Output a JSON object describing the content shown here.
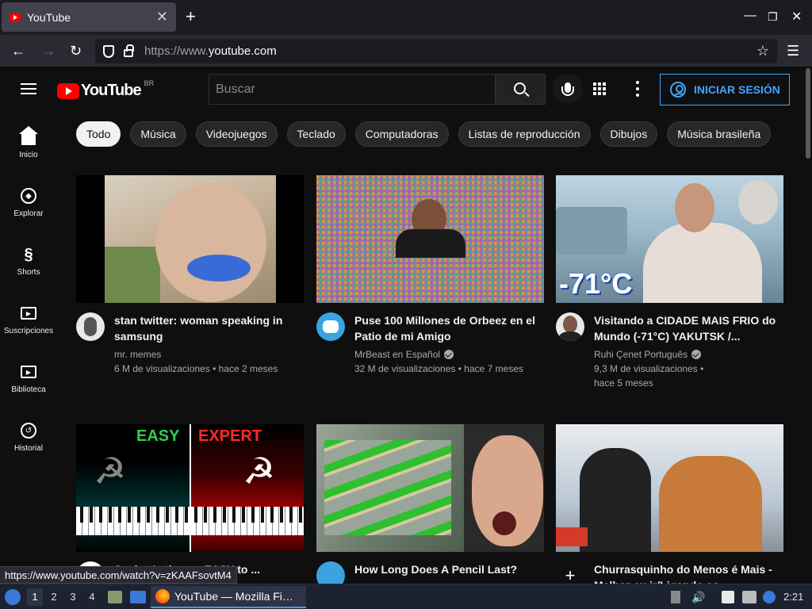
{
  "browser": {
    "tab_title": "YouTube",
    "url_prefix": "https://www.",
    "url_domain": "youtube.com",
    "status_link": "https://www.youtube.com/watch?v=zKAAFsovtM4"
  },
  "header": {
    "logo_text": "YouTube",
    "country_code": "BR",
    "search_placeholder": "Buscar",
    "signin_label": "INICIAR SESIÓN"
  },
  "sidebar": {
    "items": [
      {
        "label": "Inicio"
      },
      {
        "label": "Explorar"
      },
      {
        "label": "Shorts"
      },
      {
        "label": "Suscripciones"
      },
      {
        "label": "Biblioteca"
      },
      {
        "label": "Historial"
      }
    ]
  },
  "chips": [
    {
      "label": "Todo"
    },
    {
      "label": "Música"
    },
    {
      "label": "Videojuegos"
    },
    {
      "label": "Teclado"
    },
    {
      "label": "Computadoras"
    },
    {
      "label": "Listas de reproducción"
    },
    {
      "label": "Dibujos"
    },
    {
      "label": "Música brasileña"
    }
  ],
  "videos": [
    {
      "title": "stan twitter: woman speaking in samsung",
      "channel": "mr. memes",
      "verified": false,
      "views": "6 M de visualizaciones",
      "age": "hace 2 meses"
    },
    {
      "title": "Puse 100 Millones de Orbeez en el Patio de mi Amigo",
      "channel": "MrBeast en Español",
      "verified": true,
      "views": "32 M de visualizaciones",
      "age": "hace 7 meses"
    },
    {
      "title": "Visitando a CIDADE MAIS FRIO do Mundo (-71°C) YAKUTSK /...",
      "channel": "Ruhi Çenet Português",
      "verified": true,
      "views": "9,3 M de visualizaciones",
      "age": "hace 5 meses",
      "thumb_text": "-71°C"
    },
    {
      "title": "Soviet Anthem ~ EASY to ...",
      "thumb_easy": "EASY",
      "thumb_expert": "EXPERT"
    },
    {
      "title": "How Long Does A Pencil Last?"
    },
    {
      "title": "Churrasquinho do Menos é Mais - Melhor eu ir/Ligando os..."
    }
  ],
  "taskbar": {
    "workspaces": [
      "1",
      "2",
      "3",
      "4"
    ],
    "task_label": "YouTube — Mozilla Fi…",
    "clock": "2:21"
  }
}
